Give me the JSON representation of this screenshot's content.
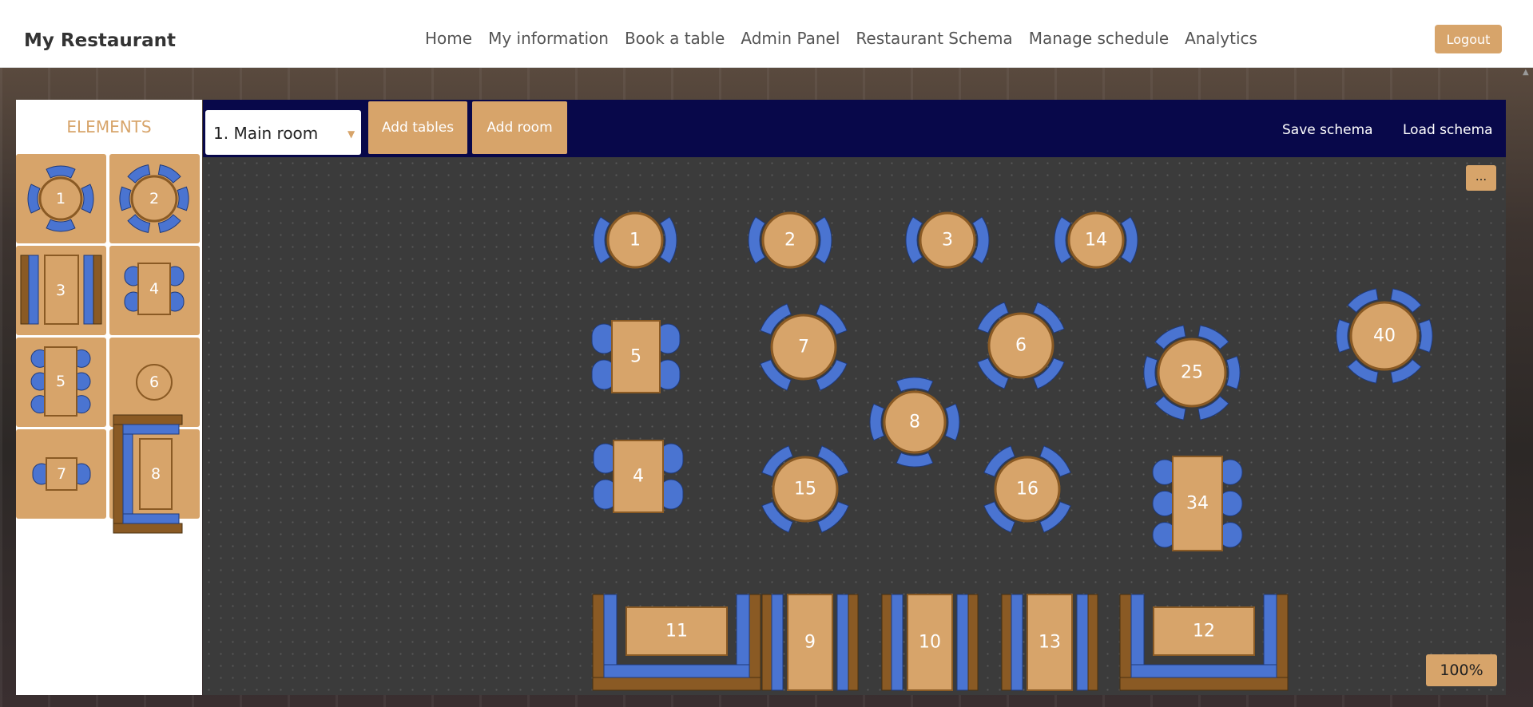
{
  "brand": "My Restaurant",
  "nav": [
    "Home",
    "My information",
    "Book a table",
    "Admin Panel",
    "Restaurant Schema",
    "Manage schedule",
    "Analytics"
  ],
  "logout_label": "Logout",
  "sidebar": {
    "title": "ELEMENTS",
    "tiles": [
      {
        "label": "1",
        "kind": "round-2"
      },
      {
        "label": "2",
        "kind": "round-6"
      },
      {
        "label": "3",
        "kind": "rect-bench"
      },
      {
        "label": "4",
        "kind": "rect-4"
      },
      {
        "label": "5",
        "kind": "rect-6"
      },
      {
        "label": "6",
        "kind": "round-plain"
      },
      {
        "label": "7",
        "kind": "rect-2"
      },
      {
        "label": "8",
        "kind": "corner-booth"
      }
    ]
  },
  "toolbar": {
    "room_selected": "1. Main room",
    "add_tables": "Add tables",
    "add_room": "Add room",
    "save_schema": "Save schema",
    "load_schema": "Load schema",
    "more": "...",
    "zoom": "100%"
  },
  "tables": [
    {
      "label": "1",
      "kind": "round-2"
    },
    {
      "label": "2",
      "kind": "round-2"
    },
    {
      "label": "3",
      "kind": "round-2"
    },
    {
      "label": "14",
      "kind": "round-2"
    },
    {
      "label": "5",
      "kind": "rect-4"
    },
    {
      "label": "4",
      "kind": "rect-4"
    },
    {
      "label": "7",
      "kind": "round-4"
    },
    {
      "label": "15",
      "kind": "round-4"
    },
    {
      "label": "8",
      "kind": "round-4-cross"
    },
    {
      "label": "6",
      "kind": "round-4"
    },
    {
      "label": "16",
      "kind": "round-4"
    },
    {
      "label": "25",
      "kind": "round-6"
    },
    {
      "label": "34",
      "kind": "rect-6"
    },
    {
      "label": "40",
      "kind": "round-6"
    },
    {
      "label": "11",
      "kind": "u-booth"
    },
    {
      "label": "9",
      "kind": "bench-booth"
    },
    {
      "label": "10",
      "kind": "bench-booth"
    },
    {
      "label": "13",
      "kind": "bench-booth"
    },
    {
      "label": "12",
      "kind": "u-booth"
    }
  ],
  "colors": {
    "table": "#d7a46a",
    "chair": "#4a74d1",
    "bench": "#8a5a24",
    "outline": "#8a5a24",
    "navbar": "#08084a"
  }
}
